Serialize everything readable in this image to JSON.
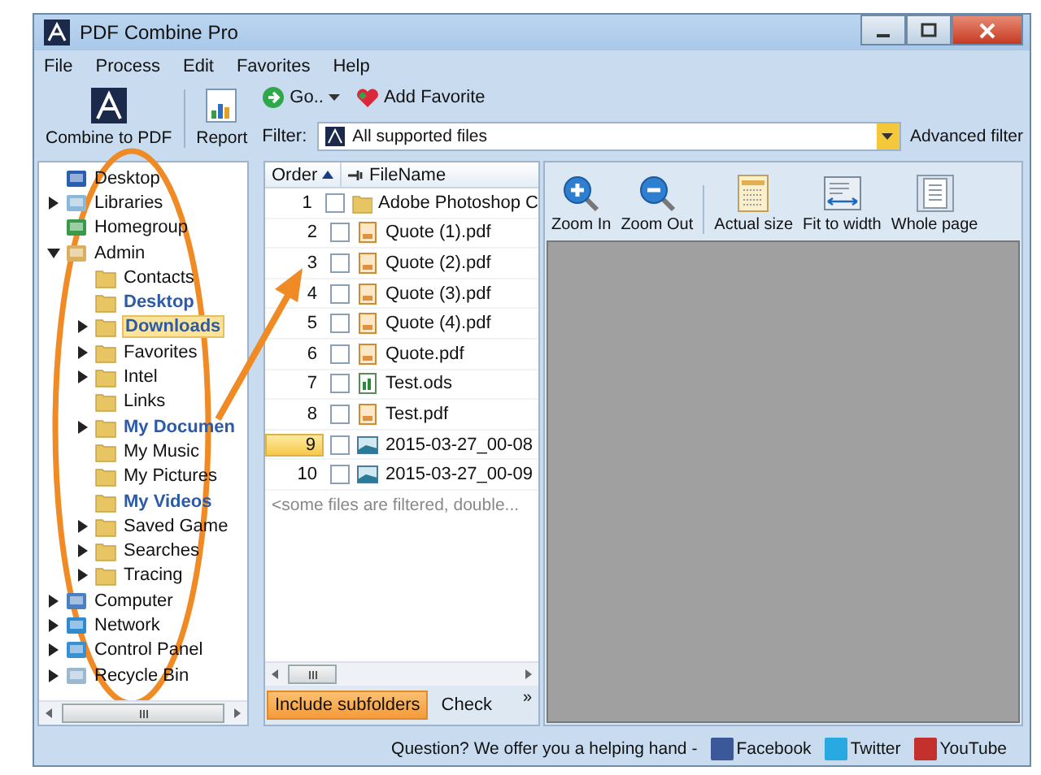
{
  "window": {
    "title": "PDF Combine Pro"
  },
  "menu": [
    "File",
    "Process",
    "Edit",
    "Favorites",
    "Help"
  ],
  "toolbar": {
    "combine": "Combine to PDF",
    "report": "Report",
    "go": "Go..",
    "add_favorite": "Add Favorite",
    "filter_label": "Filter:",
    "filter_value": "All supported files",
    "advanced_filter": "Advanced filter"
  },
  "tree": [
    {
      "label": "Desktop",
      "kind": "desktop",
      "children": [
        {
          "label": "Libraries",
          "kind": "library",
          "expanded": false
        },
        {
          "label": "Homegroup",
          "kind": "homegroup"
        },
        {
          "label": "Admin",
          "kind": "user",
          "expanded": true,
          "children": [
            {
              "label": "Contacts",
              "kind": "folder"
            },
            {
              "label": "Desktop",
              "kind": "folder",
              "highlighted": true
            },
            {
              "label": "Downloads",
              "kind": "folder",
              "highlighted": true,
              "selected": true,
              "expanded": false
            },
            {
              "label": "Favorites",
              "kind": "folder",
              "expanded": false
            },
            {
              "label": "Intel",
              "kind": "folder",
              "expanded": false
            },
            {
              "label": "Links",
              "kind": "folder"
            },
            {
              "label": "My Documen",
              "kind": "folder",
              "highlighted": true,
              "expanded": false
            },
            {
              "label": "My Music",
              "kind": "folder"
            },
            {
              "label": "My Pictures",
              "kind": "folder"
            },
            {
              "label": "My Videos",
              "kind": "folder",
              "highlighted": true
            },
            {
              "label": "Saved Game",
              "kind": "folder",
              "expanded": false
            },
            {
              "label": "Searches",
              "kind": "folder",
              "expanded": false
            },
            {
              "label": "Tracing",
              "kind": "folder",
              "expanded": false
            }
          ]
        },
        {
          "label": "Computer",
          "kind": "computer",
          "expanded": false
        },
        {
          "label": "Network",
          "kind": "network",
          "expanded": false
        },
        {
          "label": "Control Panel",
          "kind": "control-panel",
          "expanded": false
        },
        {
          "label": "Recycle Bin",
          "kind": "recycle-bin",
          "expanded": false
        }
      ]
    }
  ],
  "files": {
    "columns": [
      "Order",
      "FileName"
    ],
    "rows": [
      {
        "order": "1",
        "name": "Adobe Photoshop C",
        "kind": "folder",
        "checked": false,
        "selected": false
      },
      {
        "order": "2",
        "name": "Quote (1).pdf",
        "kind": "pdf",
        "checked": false,
        "selected": false
      },
      {
        "order": "3",
        "name": "Quote (2).pdf",
        "kind": "pdf",
        "checked": false,
        "selected": false
      },
      {
        "order": "4",
        "name": "Quote (3).pdf",
        "kind": "pdf",
        "checked": false,
        "selected": false
      },
      {
        "order": "5",
        "name": "Quote (4).pdf",
        "kind": "pdf",
        "checked": false,
        "selected": false
      },
      {
        "order": "6",
        "name": "Quote.pdf",
        "kind": "pdf",
        "checked": false,
        "selected": false
      },
      {
        "order": "7",
        "name": "Test.ods",
        "kind": "spreadsheet",
        "checked": false,
        "selected": false
      },
      {
        "order": "8",
        "name": "Test.pdf",
        "kind": "pdf",
        "checked": false,
        "selected": false
      },
      {
        "order": "9",
        "name": "2015-03-27_00-08",
        "kind": "image",
        "checked": false,
        "selected": true
      },
      {
        "order": "10",
        "name": "2015-03-27_00-09",
        "kind": "image",
        "checked": false,
        "selected": false
      }
    ],
    "note": "<some files are filtered, double...",
    "tabs": [
      {
        "label": "Include subfolders",
        "selected": true
      },
      {
        "label": "Check",
        "selected": false
      }
    ],
    "more": "»"
  },
  "preview_toolbar": [
    {
      "label": "Zoom In",
      "kind": "zoom-in"
    },
    {
      "label": "Zoom Out",
      "kind": "zoom-out"
    },
    {
      "label": "Actual size",
      "kind": "actual"
    },
    {
      "label": "Fit to width",
      "kind": "fit"
    },
    {
      "label": "Whole page",
      "kind": "page"
    }
  ],
  "status_bar": {
    "text": "Question? We offer you a helping hand -",
    "links": [
      {
        "label": "Facebook",
        "color": "#3b5998"
      },
      {
        "label": "Twitter",
        "color": "#29a9e1"
      },
      {
        "label": "YouTube",
        "color": "#c4302b"
      }
    ]
  }
}
